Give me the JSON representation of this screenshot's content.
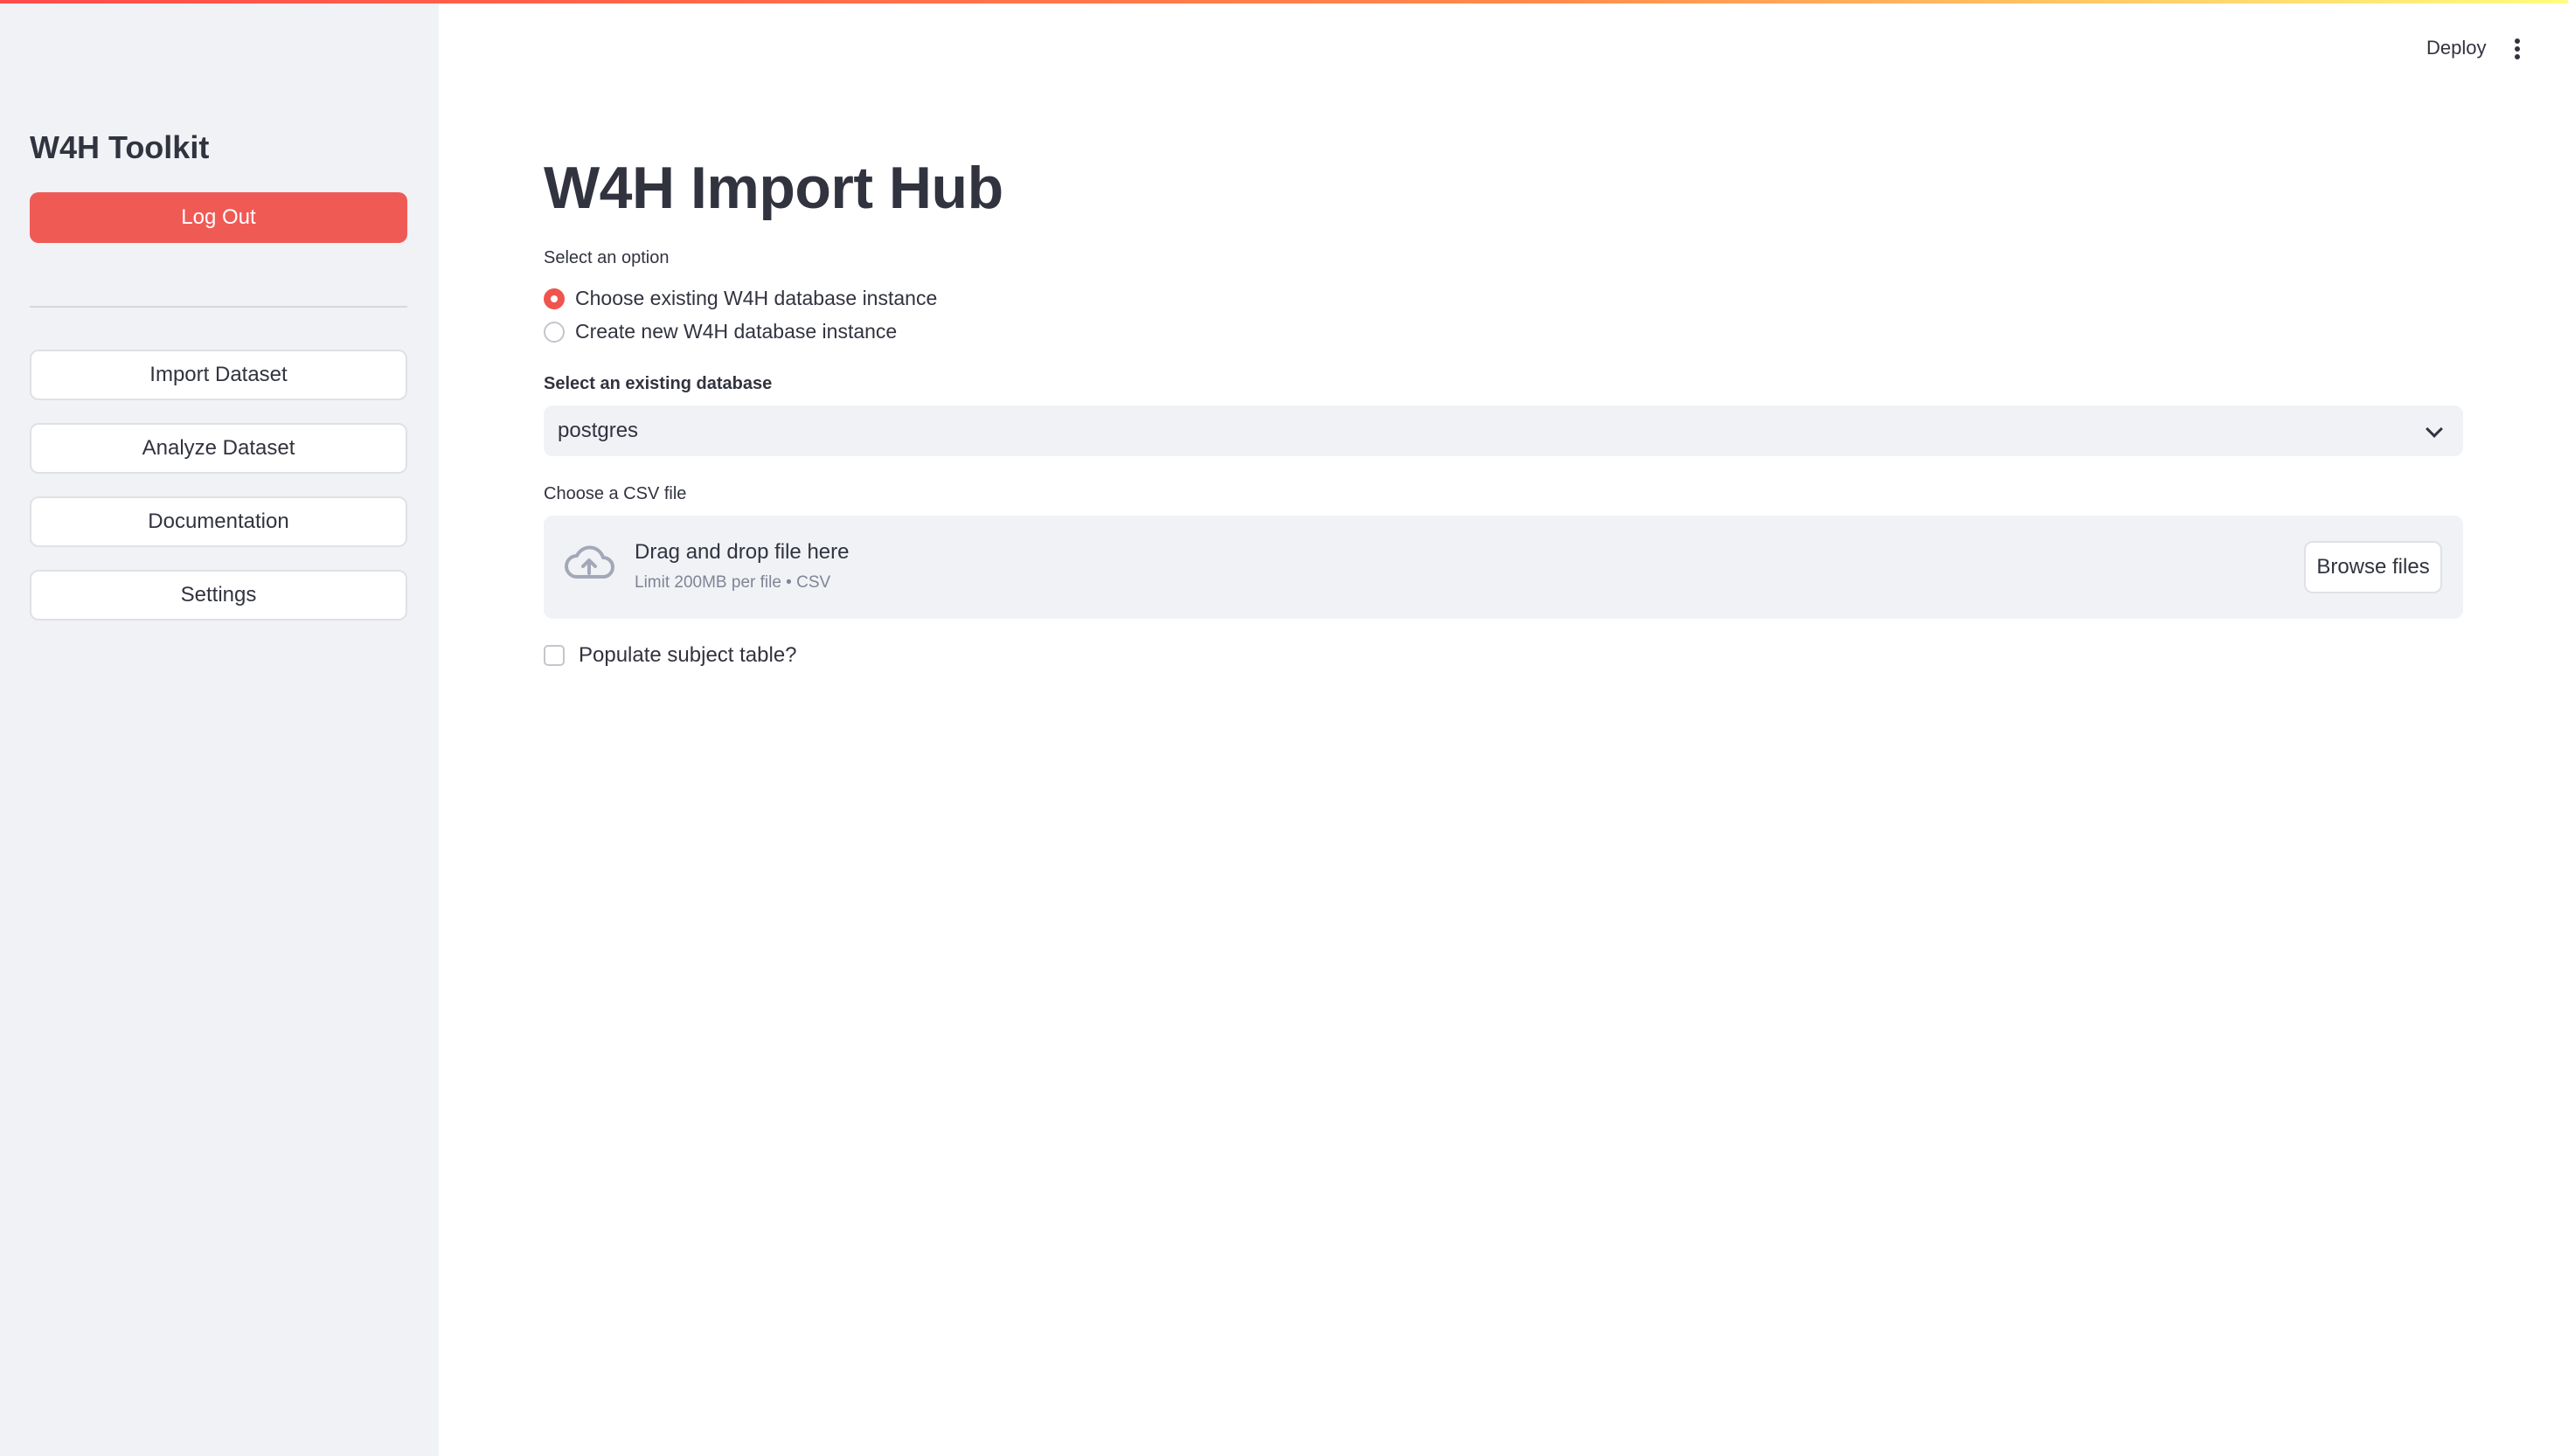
{
  "accent_color": "#f05a55",
  "sidebar": {
    "title": "W4H Toolkit",
    "logout_label": "Log Out",
    "items": [
      {
        "label": "Import Dataset"
      },
      {
        "label": "Analyze Dataset"
      },
      {
        "label": "Documentation"
      },
      {
        "label": "Settings"
      }
    ]
  },
  "header": {
    "deploy_label": "Deploy",
    "menu_icon": "vertical-ellipsis-icon"
  },
  "main": {
    "title": "W4H Import Hub",
    "option_label": "Select an option",
    "options": [
      {
        "label": "Choose existing W4H database instance",
        "selected": true
      },
      {
        "label": "Create new W4H database instance",
        "selected": false
      }
    ],
    "database_label": "Select an existing database",
    "database_value": "postgres",
    "csv_label": "Choose a CSV file",
    "dropzone": {
      "icon": "cloud-upload-icon",
      "title": "Drag and drop file here",
      "subtitle": "Limit 200MB per file • CSV",
      "browse_label": "Browse files"
    },
    "checkbox_label": "Populate subject table?",
    "checkbox_checked": false
  }
}
